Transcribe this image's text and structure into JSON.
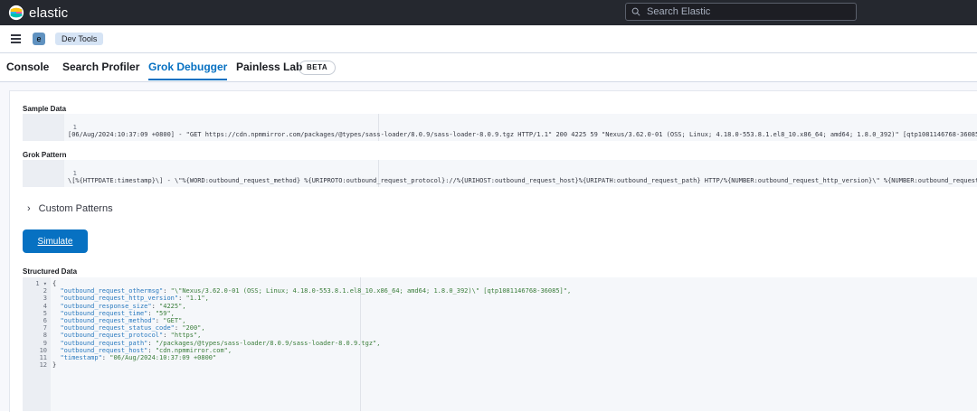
{
  "app": {
    "name": "elastic"
  },
  "search": {
    "placeholder": "Search Elastic"
  },
  "breadcrumb": {
    "space_initial": "e",
    "current": "Dev Tools"
  },
  "tabs": [
    {
      "label": "Console",
      "active": false
    },
    {
      "label": "Search Profiler",
      "active": false
    },
    {
      "label": "Grok Debugger",
      "active": true
    },
    {
      "label": "Painless Lab",
      "active": false
    }
  ],
  "beta_badge": "BETA",
  "sample_data": {
    "label": "Sample Data",
    "lines": [
      {
        "n": "1",
        "text": "[06/Aug/2024:10:37:09 +0800] - \"GET https://cdn.npmmirror.com/packages/@types/sass-loader/8.0.9/sass-loader-8.0.9.tgz HTTP/1.1\" 200 4225 59 \"Nexus/3.62.0-01 (OSS; Linux; 4.18.0-553.8.1.el8_10.x86_64; amd64; 1.8.0_392)\" [qtp1081146768-36085]"
      }
    ]
  },
  "grok_pattern": {
    "label": "Grok Pattern",
    "lines": [
      {
        "n": "1",
        "text": "\\[%{HTTPDATE:timestamp}\\] - \\\"%{WORD:outbound_request_method} %{URIPROTO:outbound_request_protocol}://%{URIHOST:outbound_request_host}%{URIPATH:outbound_request_path} HTTP/%{NUMBER:outbound_request_http_version}\\\" %{NUMBER:outbound_request_st"
      }
    ]
  },
  "custom_patterns": {
    "label": "Custom Patterns"
  },
  "simulate_button": "Simulate",
  "structured_data": {
    "label": "Structured Data",
    "lines": [
      {
        "n": "1 ▾",
        "text": "{"
      },
      {
        "n": "2",
        "text": "  \"outbound_request_othermsg\": \"\\\"Nexus/3.62.0-01 (OSS; Linux; 4.18.0-553.8.1.el8_10.x86_64; amd64; 1.8.0_392)\\\" [qtp1081146768-36085]\","
      },
      {
        "n": "3",
        "text": "  \"outbound_request_http_version\": \"1.1\","
      },
      {
        "n": "4",
        "text": "  \"outbound_response_size\": \"4225\","
      },
      {
        "n": "5",
        "text": "  \"outbound_request_time\": \"59\","
      },
      {
        "n": "6",
        "text": "  \"outbound_request_method\": \"GET\","
      },
      {
        "n": "7",
        "text": "  \"outbound_request_status_code\": \"200\","
      },
      {
        "n": "8",
        "text": "  \"outbound_request_protocol\": \"https\","
      },
      {
        "n": "9",
        "text": "  \"outbound_request_path\": \"/packages/@types/sass-loader/8.0.9/sass-loader-8.0.9.tgz\","
      },
      {
        "n": "10",
        "text": "  \"outbound_request_host\": \"cdn.npmmirror.com\","
      },
      {
        "n": "11",
        "text": "  \"timestamp\": \"06/Aug/2024:10:37:09 +0800\""
      },
      {
        "n": "12",
        "text": "}"
      }
    ]
  },
  "colors": {
    "topbar": "#25282f",
    "accent": "#0771c2",
    "badge": "#6092c0",
    "crumb": "#d6e4f5"
  }
}
